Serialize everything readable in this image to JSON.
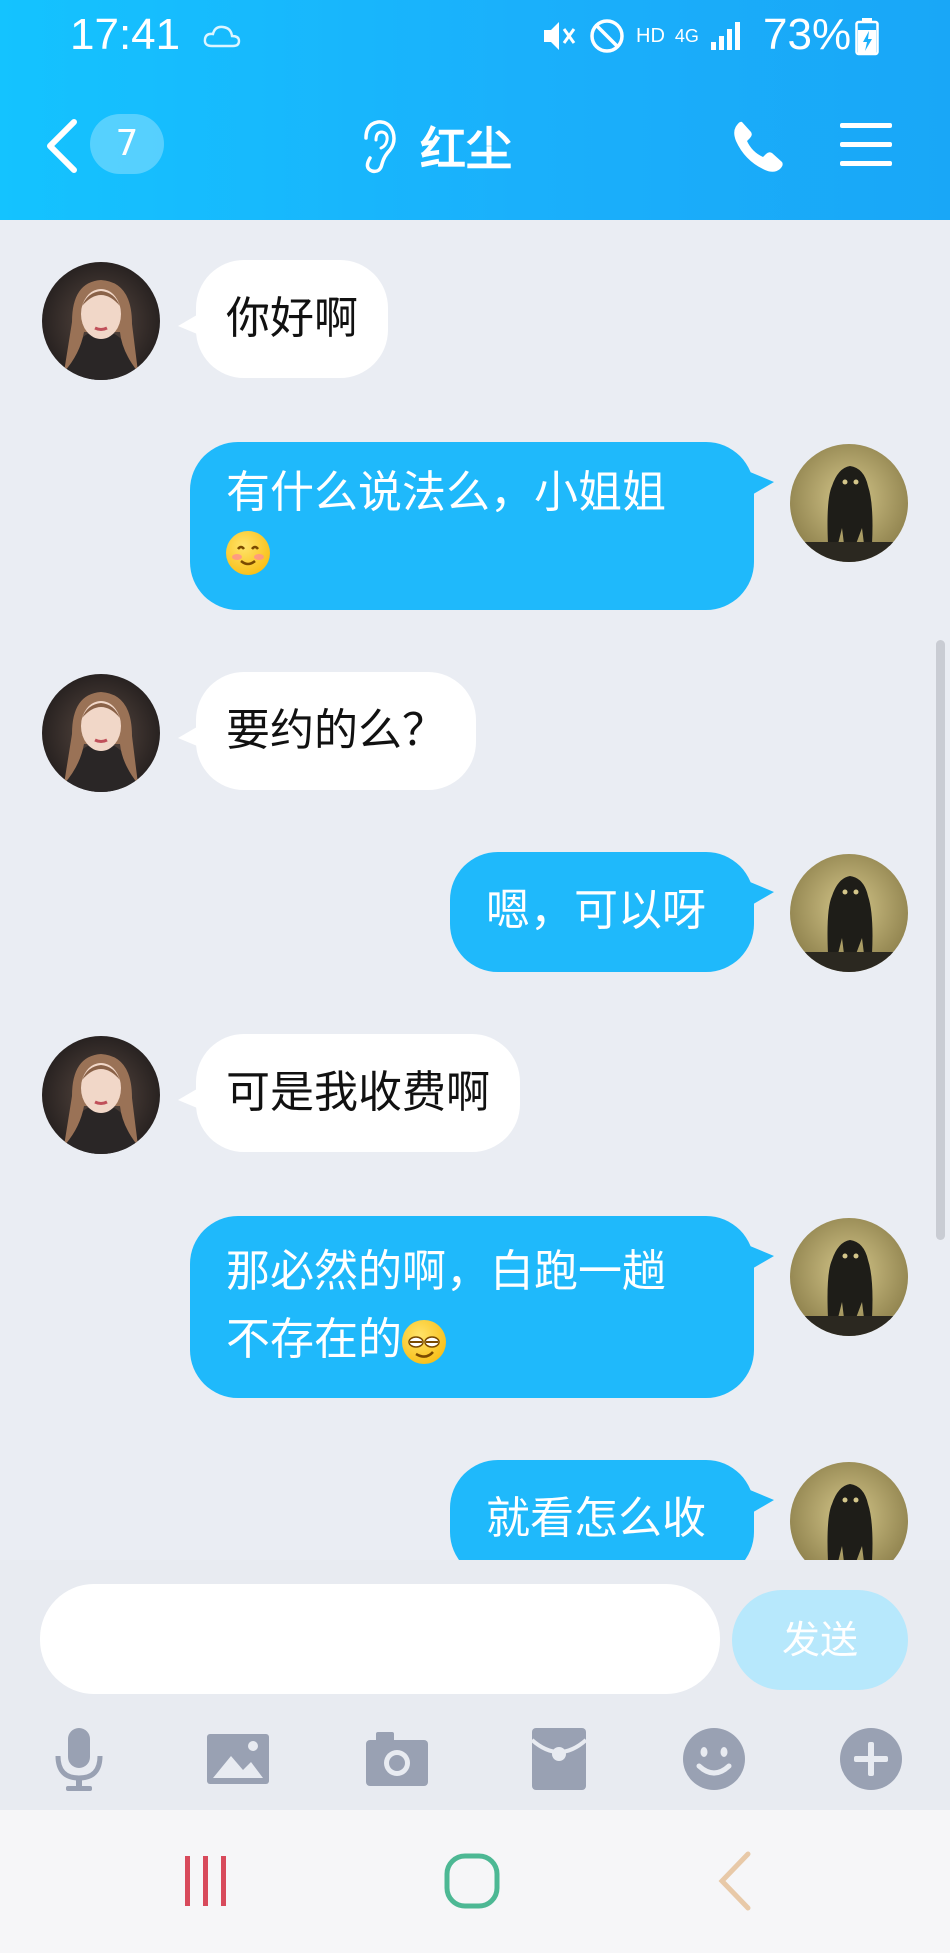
{
  "status_bar": {
    "time": "17:41",
    "battery": "73%",
    "network": "4G",
    "hd": "HD"
  },
  "header": {
    "unread_count": "7",
    "title": "红尘"
  },
  "messages": [
    {
      "side": "in",
      "text": "你好啊"
    },
    {
      "side": "out",
      "text": "有什么说法么，小姐姐",
      "emoji": "smile-blush"
    },
    {
      "side": "in",
      "text": "要约的么？"
    },
    {
      "side": "out",
      "text": "嗯，可以呀"
    },
    {
      "side": "in",
      "text": "可是我收费啊"
    },
    {
      "side": "out",
      "text_line1": "那必然的啊，白跑一趟",
      "text_line2": "不存在的",
      "emoji": "smirk-face"
    },
    {
      "side": "out",
      "text": "就看怎么收"
    }
  ],
  "input": {
    "value": "",
    "send_label": "发送"
  },
  "colors": {
    "header": "#1ab0fb",
    "outgoing_bubble": "#1fb9fb",
    "send_button": "#b7e8fc",
    "background": "#eaedf3"
  },
  "toolbar_icons": [
    "microphone-icon",
    "image-icon",
    "camera-icon",
    "red-packet-icon",
    "emoji-icon",
    "plus-icon"
  ]
}
